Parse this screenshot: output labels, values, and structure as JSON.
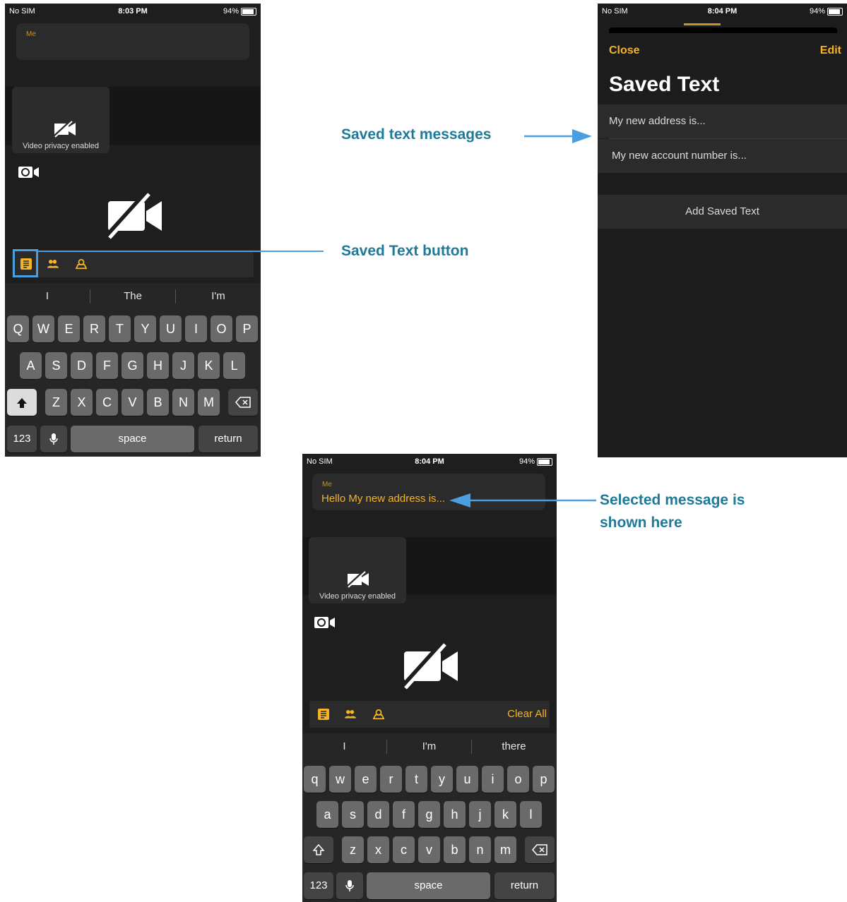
{
  "status_left": {
    "carrier": "No SIM",
    "time": "8:03 PM",
    "battery": "94%"
  },
  "status_right": {
    "carrier": "No SIM",
    "time": "8:04 PM",
    "battery": "94%"
  },
  "status_bottom": {
    "carrier": "No SIM",
    "time": "8:04 PM",
    "battery": "94%"
  },
  "screen1": {
    "me_label": "Me",
    "tile_caption": "Video privacy enabled",
    "suggestions": [
      "I",
      "The",
      "I'm"
    ],
    "row1": [
      "Q",
      "W",
      "E",
      "R",
      "T",
      "Y",
      "U",
      "I",
      "O",
      "P"
    ],
    "row2": [
      "A",
      "S",
      "D",
      "F",
      "G",
      "H",
      "J",
      "K",
      "L"
    ],
    "row3": [
      "Z",
      "X",
      "C",
      "V",
      "B",
      "N",
      "M"
    ],
    "num_key": "123",
    "space_key": "space",
    "return_key": "return"
  },
  "screen2": {
    "close_label": "Close",
    "edit_label": "Edit",
    "title": "Saved Text",
    "items": [
      "My new address is...",
      "My new account number is..."
    ],
    "add_label": "Add Saved Text"
  },
  "screen3": {
    "me_label": "Me",
    "message": "Hello My new address is...",
    "tile_caption": "Video privacy enabled",
    "clear_all": "Clear All",
    "suggestions": [
      "I",
      "I'm",
      "there"
    ],
    "row1": [
      "q",
      "w",
      "e",
      "r",
      "t",
      "y",
      "u",
      "i",
      "o",
      "p"
    ],
    "row2": [
      "a",
      "s",
      "d",
      "f",
      "g",
      "h",
      "j",
      "k",
      "l"
    ],
    "row3": [
      "z",
      "x",
      "c",
      "v",
      "b",
      "n",
      "m"
    ],
    "num_key": "123",
    "space_key": "space",
    "return_key": "return"
  },
  "callouts": {
    "saved_messages": "Saved text messages",
    "saved_button": "Saved Text button",
    "selected_line1": "Selected message is",
    "selected_line2": "shown here"
  },
  "colors": {
    "accent": "#f5b326",
    "callout": "#1f7a99",
    "arrow": "#4a9fe0"
  }
}
